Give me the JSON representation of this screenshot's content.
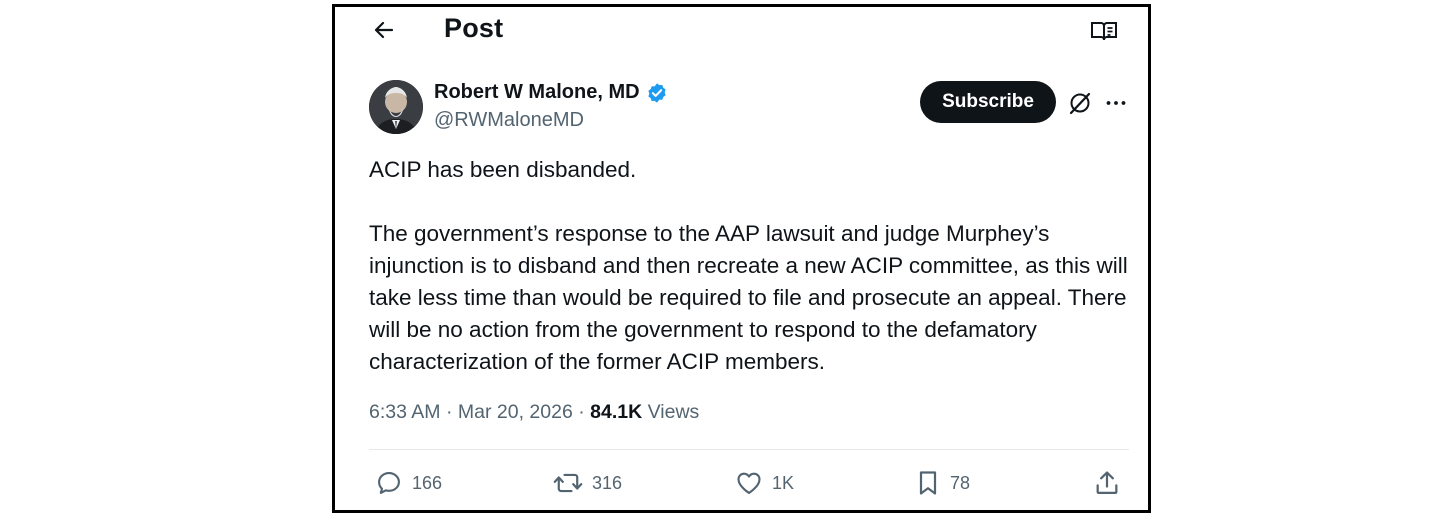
{
  "header": {
    "title": "Post",
    "back_icon": "arrow-left-icon",
    "reader_icon": "reader-mode-icon"
  },
  "author": {
    "name": "Robert W Malone, MD",
    "handle": "@RWMaloneMD",
    "verified": true,
    "verified_color": "#1d9bf0",
    "subscribe_label": "Subscribe"
  },
  "tweet": {
    "paragraphs": [
      "ACIP has been disbanded.",
      "The government’s response to the AAP lawsuit and judge Murphey’s injunction is to disband and then recreate a new ACIP committee, as this will take less time than would be required to file and prosecute an appeal.  There will be no action from the government to respond to the defamatory characterization of the former ACIP members."
    ]
  },
  "meta": {
    "time": "6:33 AM",
    "separator": "·",
    "date": "Mar 20, 2026",
    "views_count": "84.1K",
    "views_label": "Views"
  },
  "actions": {
    "replies": "166",
    "reposts": "316",
    "likes": "1K",
    "bookmarks": "78"
  },
  "colors": {
    "text_primary": "#0f1419",
    "text_secondary": "#536471",
    "button_bg": "#0f1419",
    "verified": "#1d9bf0",
    "frame_border": "#000000"
  }
}
